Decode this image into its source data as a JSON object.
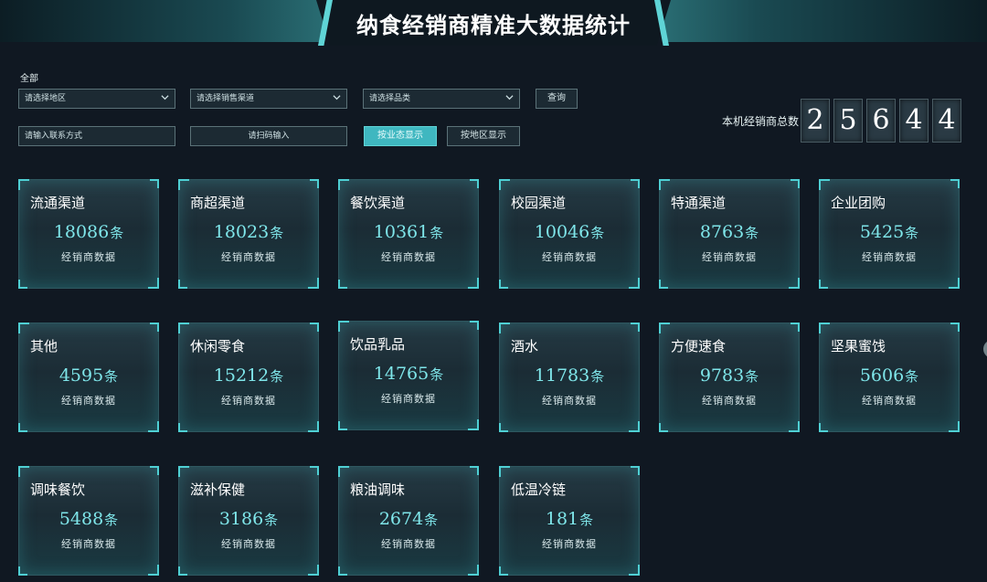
{
  "header": {
    "title": "纳食经销商精准大数据统计"
  },
  "filters": {
    "all_label": "全部",
    "region_placeholder": "请选择地区",
    "channel_placeholder": "请选择销售渠道",
    "category_placeholder": "请选择品类",
    "query_label": "查询",
    "contact_placeholder": "请输入联系方式",
    "scan_placeholder": "请扫码输入",
    "by_business_label": "按业态显示",
    "by_region_label": "按地区显示"
  },
  "total": {
    "label": "本机经销商总数",
    "digits": [
      "2",
      "5",
      "6",
      "4",
      "4"
    ]
  },
  "cards": [
    {
      "name": "流通渠道",
      "count": "18086",
      "unit": "条",
      "sub": "经销商数据"
    },
    {
      "name": "商超渠道",
      "count": "18023",
      "unit": "条",
      "sub": "经销商数据"
    },
    {
      "name": "餐饮渠道",
      "count": "10361",
      "unit": "条",
      "sub": "经销商数据"
    },
    {
      "name": "校园渠道",
      "count": "10046",
      "unit": "条",
      "sub": "经销商数据"
    },
    {
      "name": "特通渠道",
      "count": "8763",
      "unit": "条",
      "sub": "经销商数据"
    },
    {
      "name": "企业团购",
      "count": "5425",
      "unit": "条",
      "sub": "经销商数据"
    },
    {
      "name": "其他",
      "count": "4595",
      "unit": "条",
      "sub": "经销商数据"
    },
    {
      "name": "休闲零食",
      "count": "15212",
      "unit": "条",
      "sub": "经销商数据"
    },
    {
      "name": "饮品乳品",
      "count": "14765",
      "unit": "条",
      "sub": "经销商数据"
    },
    {
      "name": "酒水",
      "count": "11783",
      "unit": "条",
      "sub": "经销商数据"
    },
    {
      "name": "方便速食",
      "count": "9783",
      "unit": "条",
      "sub": "经销商数据"
    },
    {
      "name": "坚果蜜饯",
      "count": "5606",
      "unit": "条",
      "sub": "经销商数据"
    },
    {
      "name": "调味餐饮",
      "count": "5488",
      "unit": "条",
      "sub": "经销商数据"
    },
    {
      "name": "滋补保健",
      "count": "3186",
      "unit": "条",
      "sub": "经销商数据"
    },
    {
      "name": "粮油调味",
      "count": "2674",
      "unit": "条",
      "sub": "经销商数据"
    },
    {
      "name": "低温冷链",
      "count": "181",
      "unit": "条",
      "sub": "经销商数据"
    }
  ],
  "colors": {
    "background": "#101822",
    "accent": "#5fd4d6",
    "count_text": "#7fe6ea",
    "active_button": "#3fb7c0"
  }
}
